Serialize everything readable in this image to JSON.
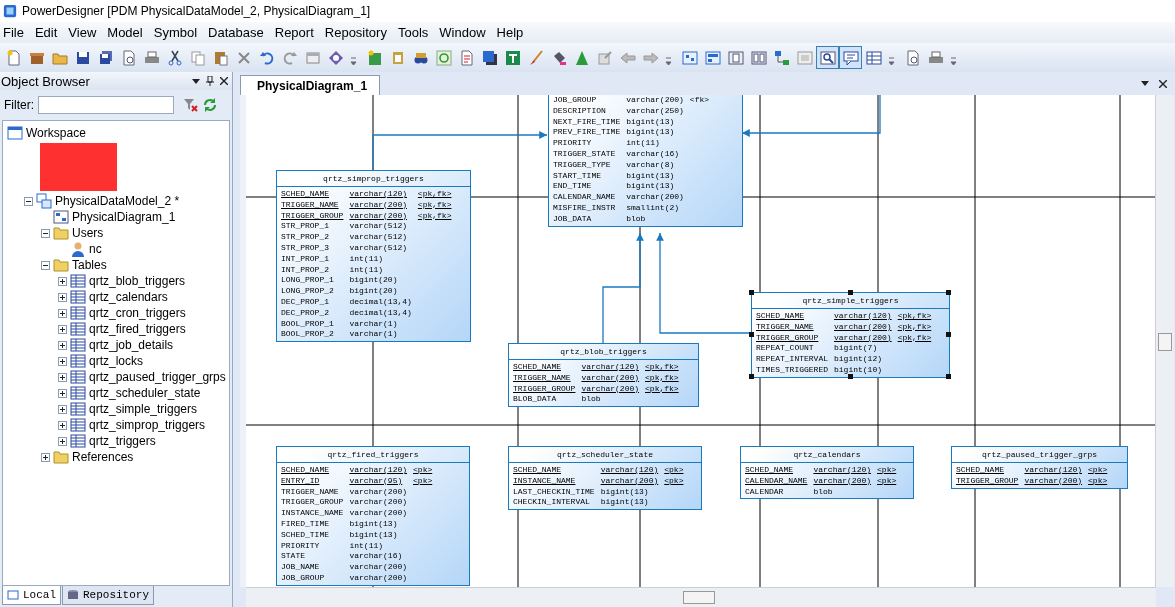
{
  "window": {
    "title": "PowerDesigner [PDM PhysicalDataModel_2, PhysicalDiagram_1]"
  },
  "menu": [
    "File",
    "Edit",
    "View",
    "Model",
    "Symbol",
    "Database",
    "Report",
    "Repository",
    "Tools",
    "Window",
    "Help"
  ],
  "toolbar": [
    {
      "buttons": [
        {
          "pressed": false
        },
        {
          "pressed": false
        },
        {
          "pressed": false
        },
        {
          "pressed": false
        },
        {
          "pressed": false
        },
        {
          "pressed": false
        },
        {
          "pressed": false
        },
        {
          "pressed": false
        },
        {
          "pressed": false
        },
        {
          "pressed": false
        },
        {
          "pressed": false
        },
        {
          "pressed": false
        },
        {
          "pressed": false
        },
        {
          "pressed": false
        },
        {
          "pressed": false
        }
      ]
    },
    {
      "buttons": [
        {
          "pressed": false
        },
        {
          "pressed": false
        },
        {
          "pressed": false
        },
        {
          "pressed": false
        },
        {
          "pressed": false
        },
        {
          "pressed": false
        },
        {
          "pressed": false
        },
        {
          "pressed": false
        },
        {
          "pressed": false
        },
        {
          "pressed": false
        },
        {
          "pressed": false
        },
        {
          "pressed": false
        },
        {
          "pressed": false
        }
      ]
    },
    {
      "buttons": [
        {
          "pressed": false
        },
        {
          "pressed": false
        },
        {
          "pressed": false
        },
        {
          "pressed": false
        },
        {
          "pressed": false
        },
        {
          "pressed": false
        },
        {
          "pressed": true
        },
        {
          "pressed": true
        },
        {
          "pressed": false
        }
      ]
    },
    {
      "buttons": [
        {
          "pressed": false
        },
        {
          "pressed": false
        }
      ]
    }
  ],
  "object_browser": {
    "title": "Object Browser",
    "filter_label": "Filter:",
    "tree": [
      {
        "label": "Workspace",
        "kind": "workspace",
        "children": [
          {
            "kind": "redacted"
          },
          {
            "label": "PhysicalDataModel_2 *",
            "kind": "model",
            "expanded": true,
            "children": [
              {
                "label": "PhysicalDiagram_1",
                "kind": "diagram"
              },
              {
                "label": "Users",
                "kind": "folder",
                "expanded": true,
                "children": [
                  {
                    "label": "nc",
                    "kind": "user"
                  }
                ]
              },
              {
                "label": "Tables",
                "kind": "folder",
                "expanded": true,
                "children": [
                  {
                    "label": "qrtz_blob_triggers",
                    "kind": "table",
                    "expanded": false
                  },
                  {
                    "label": "qrtz_calendars",
                    "kind": "table",
                    "expanded": false
                  },
                  {
                    "label": "qrtz_cron_triggers",
                    "kind": "table",
                    "expanded": false
                  },
                  {
                    "label": "qrtz_fired_triggers",
                    "kind": "table",
                    "expanded": false
                  },
                  {
                    "label": "qrtz_job_details",
                    "kind": "table",
                    "expanded": false
                  },
                  {
                    "label": "qrtz_locks",
                    "kind": "table",
                    "expanded": false
                  },
                  {
                    "label": "qrtz_paused_trigger_grps",
                    "kind": "table",
                    "expanded": false
                  },
                  {
                    "label": "qrtz_scheduler_state",
                    "kind": "table",
                    "expanded": false
                  },
                  {
                    "label": "qrtz_simple_triggers",
                    "kind": "table",
                    "expanded": false
                  },
                  {
                    "label": "qrtz_simprop_triggers",
                    "kind": "table",
                    "expanded": false
                  },
                  {
                    "label": "qrtz_triggers",
                    "kind": "table",
                    "expanded": false
                  }
                ]
              },
              {
                "label": "References",
                "kind": "folder",
                "expanded": false
              }
            ]
          }
        ]
      }
    ],
    "tabs": [
      {
        "label": "Local",
        "selected": true
      },
      {
        "label": "Repository",
        "selected": false
      }
    ]
  },
  "diagram_tab": {
    "label": "PhysicalDiagram_1",
    "selected": true
  },
  "tables": [
    {
      "selected": false,
      "columns": [
        {
          "name": "JOB_GROUP",
          "type": "varchar(200)",
          "key": "<fk>",
          "underlined": false
        },
        {
          "name": "DESCRIPTION",
          "type": "varchar(250)",
          "underlined": false
        },
        {
          "name": "NEXT_FIRE_TIME",
          "type": "bigint(13)",
          "underlined": false
        },
        {
          "name": "PREV_FIRE_TIME",
          "type": "bigint(13)",
          "underlined": false
        },
        {
          "name": "PRIORITY",
          "type": "int(11)",
          "underlined": false
        },
        {
          "name": "TRIGGER_STATE",
          "type": "varchar(16)",
          "underlined": false
        },
        {
          "name": "TRIGGER_TYPE",
          "type": "varchar(8)",
          "underlined": false
        },
        {
          "name": "START_TIME",
          "type": "bigint(13)",
          "underlined": false
        },
        {
          "name": "END_TIME",
          "type": "bigint(13)",
          "underlined": false
        },
        {
          "name": "CALENDAR_NAME",
          "type": "varchar(200)",
          "underlined": false
        },
        {
          "name": "MISFIRE_INSTR",
          "type": "smallint(2)",
          "underlined": false
        },
        {
          "name": "JOB_DATA",
          "type": "blob",
          "underlined": false
        }
      ]
    },
    {
      "title": "qrtz_simprop_triggers",
      "selected": false,
      "columns": [
        {
          "name": "SCHED_NAME",
          "type": "varchar(120)",
          "key": "<pk,fk>",
          "underlined": true
        },
        {
          "name": "TRIGGER_NAME",
          "type": "varchar(200)",
          "key": "<pk,fk>",
          "underlined": true
        },
        {
          "name": "TRIGGER_GROUP",
          "type": "varchar(200)",
          "key": "<pk,fk>",
          "underlined": true
        },
        {
          "name": "STR_PROP_1",
          "type": "varchar(512)",
          "underlined": false
        },
        {
          "name": "STR_PROP_2",
          "type": "varchar(512)",
          "underlined": false
        },
        {
          "name": "STR_PROP_3",
          "type": "varchar(512)",
          "underlined": false
        },
        {
          "name": "INT_PROP_1",
          "type": "int(11)",
          "underlined": false
        },
        {
          "name": "INT_PROP_2",
          "type": "int(11)",
          "underlined": false
        },
        {
          "name": "LONG_PROP_1",
          "type": "bigint(20)",
          "underlined": false
        },
        {
          "name": "LONG_PROP_2",
          "type": "bigint(20)",
          "underlined": false
        },
        {
          "name": "DEC_PROP_1",
          "type": "decimal(13,4)",
          "underlined": false
        },
        {
          "name": "DEC_PROP_2",
          "type": "decimal(13,4)",
          "underlined": false
        },
        {
          "name": "BOOL_PROP_1",
          "type": "varchar(1)",
          "underlined": false
        },
        {
          "name": "BOOL_PROP_2",
          "type": "varchar(1)",
          "underlined": false
        }
      ]
    },
    {
      "title": "qrtz_blob_triggers",
      "selected": false,
      "columns": [
        {
          "name": "SCHED_NAME",
          "type": "varchar(120)",
          "key": "<pk,fk>",
          "underlined": true
        },
        {
          "name": "TRIGGER_NAME",
          "type": "varchar(200)",
          "key": "<pk,fk>",
          "underlined": true
        },
        {
          "name": "TRIGGER_GROUP",
          "type": "varchar(200)",
          "key": "<pk,fk>",
          "underlined": true
        },
        {
          "name": "BLOB_DATA",
          "type": "blob",
          "underlined": false
        }
      ]
    },
    {
      "title": "qrtz_simple_triggers",
      "selected": true,
      "columns": [
        {
          "name": "SCHED_NAME",
          "type": "varchar(120)",
          "key": "<pk,fk>",
          "underlined": true
        },
        {
          "name": "TRIGGER_NAME",
          "type": "varchar(200)",
          "key": "<pk,fk>",
          "underlined": true
        },
        {
          "name": "TRIGGER_GROUP",
          "type": "varchar(200)",
          "key": "<pk,fk>",
          "underlined": true
        },
        {
          "name": "REPEAT_COUNT",
          "type": "bigint(7)",
          "underlined": false
        },
        {
          "name": "REPEAT_INTERVAL",
          "type": "bigint(12)",
          "underlined": false
        },
        {
          "name": "TIMES_TRIGGERED",
          "type": "bigint(10)",
          "underlined": false
        }
      ]
    },
    {
      "title": "qrtz_fired_triggers",
      "selected": false,
      "columns": [
        {
          "name": "SCHED_NAME",
          "type": "varchar(120)",
          "key": "<pk>",
          "underlined": true
        },
        {
          "name": "ENTRY_ID",
          "type": "varchar(95)",
          "key": "<pk>",
          "underlined": true
        },
        {
          "name": "TRIGGER_NAME",
          "type": "varchar(200)",
          "underlined": false
        },
        {
          "name": "TRIGGER_GROUP",
          "type": "varchar(200)",
          "underlined": false
        },
        {
          "name": "INSTANCE_NAME",
          "type": "varchar(200)",
          "underlined": false
        },
        {
          "name": "FIRED_TIME",
          "type": "bigint(13)",
          "underlined": false
        },
        {
          "name": "SCHED_TIME",
          "type": "bigint(13)",
          "underlined": false
        },
        {
          "name": "PRIORITY",
          "type": "int(11)",
          "underlined": false
        },
        {
          "name": "STATE",
          "type": "varchar(16)",
          "underlined": false
        },
        {
          "name": "JOB_NAME",
          "type": "varchar(200)",
          "underlined": false
        },
        {
          "name": "JOB_GROUP",
          "type": "varchar(200)",
          "underlined": false
        }
      ]
    },
    {
      "title": "qrtz_scheduler_state",
      "selected": false,
      "columns": [
        {
          "name": "SCHED_NAME",
          "type": "varchar(120)",
          "key": "<pk>",
          "underlined": true
        },
        {
          "name": "INSTANCE_NAME",
          "type": "varchar(200)",
          "key": "<pk>",
          "underlined": true
        },
        {
          "name": "LAST_CHECKIN_TIME",
          "type": "bigint(13)",
          "underlined": false
        },
        {
          "name": "CHECKIN_INTERVAL",
          "type": "bigint(13)",
          "underlined": false
        }
      ]
    },
    {
      "title": "qrtz_calendars",
      "selected": false,
      "columns": [
        {
          "name": "SCHED_NAME",
          "type": "varchar(120)",
          "key": "<pk>",
          "underlined": true
        },
        {
          "name": "CALENDAR_NAME",
          "type": "varchar(200)",
          "key": "<pk>",
          "underlined": true
        },
        {
          "name": "CALENDAR",
          "type": "blob",
          "underlined": false
        }
      ]
    },
    {
      "title": "qrtz_paused_trigger_grps",
      "selected": false,
      "columns": [
        {
          "name": "SCHED_NAME",
          "type": "varchar(120)",
          "key": "<pk>",
          "underlined": true
        },
        {
          "name": "TRIGGER_GROUP",
          "type": "varchar(200)",
          "key": "<pk>",
          "underlined": true
        }
      ]
    }
  ]
}
